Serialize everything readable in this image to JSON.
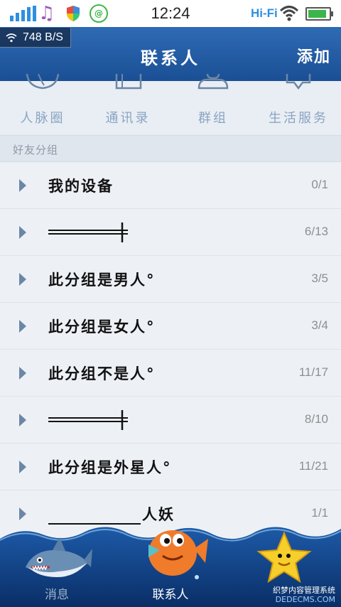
{
  "status_bar": {
    "time": "12:24",
    "network_label": "Hi-Fi",
    "icons": [
      "signal-icon",
      "music-icon",
      "shield-icon",
      "app-notification-icon",
      "wifi-icon",
      "battery-icon"
    ],
    "battery_level": 0.9
  },
  "title_bar": {
    "speed": "748 B/S",
    "title": "联系人",
    "add_label": "添加"
  },
  "quick_nav": [
    {
      "label": "人脉圈",
      "icon": "globe-icon"
    },
    {
      "label": "通讯录",
      "icon": "address-book-icon"
    },
    {
      "label": "群组",
      "icon": "group-icon"
    },
    {
      "label": "生活服务",
      "icon": "service-icon"
    }
  ],
  "section": {
    "title": "好友分组"
  },
  "groups": [
    {
      "name": "我的设备",
      "count": "0/1"
    },
    {
      "name": "",
      "count": "6/13"
    },
    {
      "name": "此分组是男人°",
      "count": "3/5"
    },
    {
      "name": "此分组是女人°",
      "count": "3/4"
    },
    {
      "name": "此分组不是人°",
      "count": "11/17"
    },
    {
      "name": "",
      "count": "8/10"
    },
    {
      "name": "此分组是外星人°",
      "count": "11/21"
    },
    {
      "name": "人妖",
      "count": "1/1"
    }
  ],
  "tabs": [
    {
      "label": "消息",
      "icon": "shark-icon",
      "active": false
    },
    {
      "label": "联系人",
      "icon": "fish-icon",
      "active": true
    },
    {
      "label": "",
      "icon": "starfish-icon",
      "active": false
    }
  ],
  "watermark": {
    "line1": "织梦内容管理系统",
    "line2": "DEDECMS.COM"
  },
  "colors": {
    "title_bar": "#2f6bb5",
    "accent_blue": "#2e8fe0",
    "list_bg": "#edf1f6",
    "tab_active": "#ffffff",
    "tab_inactive": "#9fb3c8"
  }
}
